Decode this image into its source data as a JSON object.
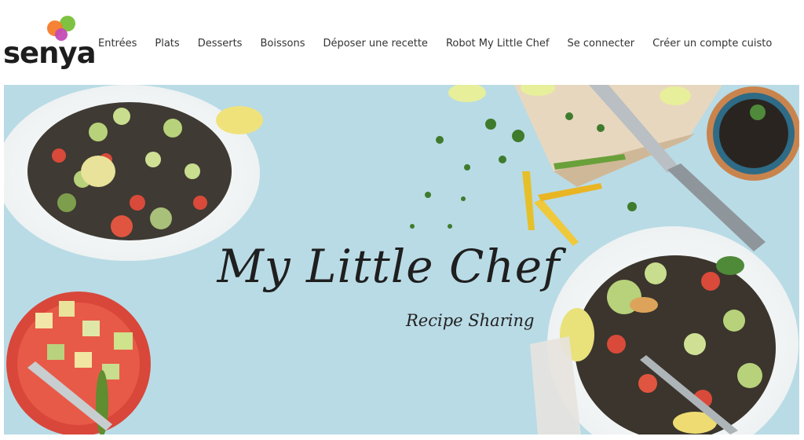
{
  "brand": {
    "name": "senya",
    "dot_colors": [
      "#7fc242",
      "#f57c2a",
      "#c44ab8"
    ]
  },
  "nav": {
    "items": [
      {
        "label": "Entrées"
      },
      {
        "label": "Plats"
      },
      {
        "label": "Desserts"
      },
      {
        "label": "Boissons"
      },
      {
        "label": "Déposer une recette"
      },
      {
        "label": "Robot My Little Chef"
      },
      {
        "label": "Se connecter"
      },
      {
        "label": "Créer un compte cuisto"
      }
    ]
  },
  "hero": {
    "title": "My Little Chef",
    "subtitle": "Recipe Sharing",
    "background_color": "#b8dbe5"
  }
}
